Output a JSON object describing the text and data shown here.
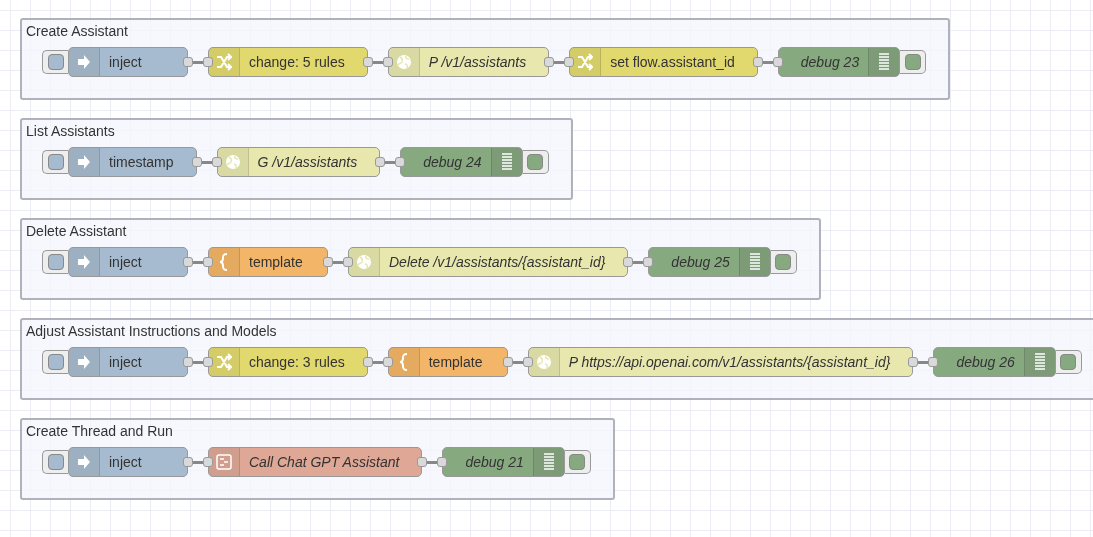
{
  "groups": [
    {
      "title": "Create Assistant",
      "nodes": [
        {
          "kind": "inject",
          "label": "inject"
        },
        {
          "kind": "change",
          "label": "change: 5 rules"
        },
        {
          "kind": "http",
          "label": "P /v1/assistants"
        },
        {
          "kind": "change",
          "label": "set flow.assistant_id"
        },
        {
          "kind": "debug",
          "label": "debug 23"
        }
      ]
    },
    {
      "title": "List Assistants",
      "nodes": [
        {
          "kind": "inject",
          "label": "timestamp"
        },
        {
          "kind": "http",
          "label": "G /v1/assistants"
        },
        {
          "kind": "debug",
          "label": "debug 24"
        }
      ]
    },
    {
      "title": "Delete Assistant",
      "nodes": [
        {
          "kind": "inject",
          "label": "inject"
        },
        {
          "kind": "template",
          "label": "template"
        },
        {
          "kind": "http",
          "label": "Delete /v1/assistants/{assistant_id}"
        },
        {
          "kind": "debug",
          "label": "debug 25"
        }
      ]
    },
    {
      "title": "Adjust Assistant Instructions and Models",
      "nodes": [
        {
          "kind": "inject",
          "label": "inject"
        },
        {
          "kind": "change",
          "label": "change: 3 rules"
        },
        {
          "kind": "template",
          "label": "template"
        },
        {
          "kind": "http",
          "label": "P https://api.openai.com/v1/assistants/{assistant_id}"
        },
        {
          "kind": "debug",
          "label": "debug 26"
        }
      ]
    },
    {
      "title": "Create Thread and Run",
      "nodes": [
        {
          "kind": "inject",
          "label": "inject"
        },
        {
          "kind": "subflow",
          "label": "Call Chat GPT Assistant"
        },
        {
          "kind": "debug",
          "label": "debug 21"
        }
      ]
    }
  ]
}
